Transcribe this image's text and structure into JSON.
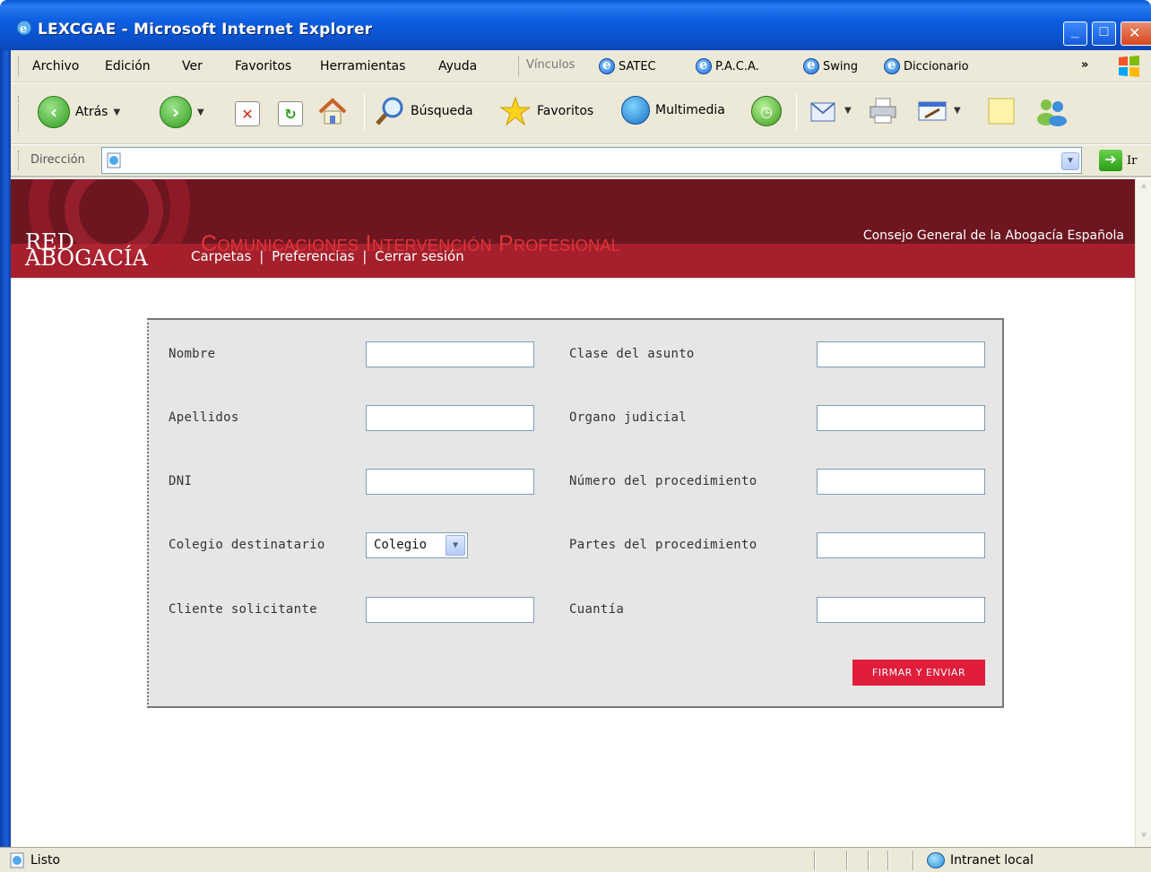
{
  "window": {
    "title": "LEXCGAE - Microsoft Internet Explorer"
  },
  "menubar": {
    "items": [
      "Archivo",
      "Edición",
      "Ver",
      "Favoritos",
      "Herramientas",
      "Ayuda"
    ],
    "links_label": "Vínculos",
    "links": [
      "SATEC",
      "P.A.C.A.",
      "Swing",
      "Diccionario"
    ],
    "overflow": "»"
  },
  "toolbar": {
    "back_label": "Atrás",
    "search_label": "Búsqueda",
    "favorites_label": "Favoritos",
    "media_label": "Multimedia"
  },
  "addressbar": {
    "label": "Dirección",
    "url": "",
    "go_label": "Ir"
  },
  "banner": {
    "logo_line1": "RED",
    "logo_line2": "ABOGACÍA",
    "app_title": "Comunicaciones Intervención Profesional",
    "organization": "Consejo General de la Abogacía Española",
    "nav": [
      "Carpetas",
      "Preferencias",
      "Cerrar sesión"
    ],
    "nav_separator": "|"
  },
  "form": {
    "left_fields": [
      {
        "label": "Nombre",
        "value": ""
      },
      {
        "label": "Apellidos",
        "value": ""
      },
      {
        "label": "DNI",
        "value": ""
      },
      {
        "label": "Colegio destinatario",
        "select_value": "Colegio"
      },
      {
        "label": "Cliente solicitante",
        "value": ""
      }
    ],
    "right_fields": [
      {
        "label": "Clase del asunto",
        "value": ""
      },
      {
        "label": "Organo judicial",
        "value": ""
      },
      {
        "label": "Número del procedimiento",
        "value": ""
      },
      {
        "label": "Partes del procedimiento",
        "value": ""
      },
      {
        "label": "Cuantía",
        "value": ""
      }
    ],
    "submit_label": "FIRMAR Y ENVIAR"
  },
  "statusbar": {
    "status": "Listo",
    "zone": "Intranet local"
  },
  "colors": {
    "banner_dark": "#6d1620",
    "banner_nav": "#a5202c",
    "title_red": "#e0343b",
    "submit_red": "#e01d3a",
    "form_bg": "#e6e6e6"
  }
}
